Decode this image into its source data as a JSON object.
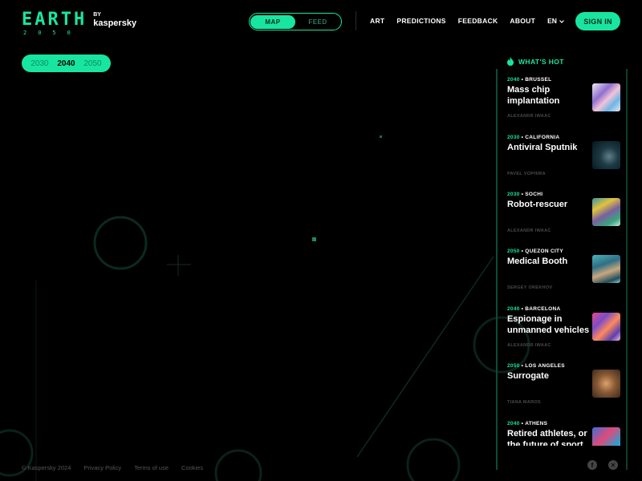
{
  "header": {
    "logo_word": "EARTH",
    "logo_year": "2050",
    "logo_by": "BY",
    "logo_brand": "kaspersky",
    "view_toggle": {
      "options": [
        "MAP",
        "FEED"
      ],
      "active": "MAP"
    },
    "nav": [
      "ART",
      "PREDICTIONS",
      "FEEDBACK",
      "ABOUT"
    ],
    "language": "EN",
    "sign_in_label": "SIGN IN"
  },
  "year_switch": {
    "options": [
      "2030",
      "2040",
      "2050"
    ],
    "active": "2040"
  },
  "whats_hot": {
    "title": "WHAT'S HOT",
    "items": [
      {
        "year": "2040",
        "city": "BRUSSEL",
        "title": "Mass chip implantation",
        "author": "ALEXANDR IWAAC"
      },
      {
        "year": "2030",
        "city": "CALIFORNIA",
        "title": "Antiviral Sputnik",
        "author": "PAVEL VOPHIRA"
      },
      {
        "year": "2030",
        "city": "SOCHI",
        "title": "Robot-rescuer",
        "author": "ALEXANDR IWAAC"
      },
      {
        "year": "2050",
        "city": "QUEZON CITY",
        "title": "Medical Booth",
        "author": "SERGEY OREKHOV"
      },
      {
        "year": "2040",
        "city": "BARCELONA",
        "title": "Espionage in unmanned vehicles",
        "author": "ALEXANDR IWAAC"
      },
      {
        "year": "2050",
        "city": "LOS ANGELES",
        "title": "Surrogate",
        "author": "TIANA MAROS"
      },
      {
        "year": "2040",
        "city": "ATHENS",
        "title": "Retired athletes, or the future of sport",
        "author": ""
      }
    ]
  },
  "footer": {
    "copyright": "© Kaspersky 2024",
    "links": [
      "Privacy Policy",
      "Terms of use",
      "Cookies"
    ]
  },
  "colors": {
    "accent": "#18e6a0",
    "background": "#000000",
    "muted": "#555555"
  },
  "icons": [
    "search-icon",
    "chevron-down-icon",
    "flame-icon",
    "facebook-icon",
    "x-icon"
  ]
}
